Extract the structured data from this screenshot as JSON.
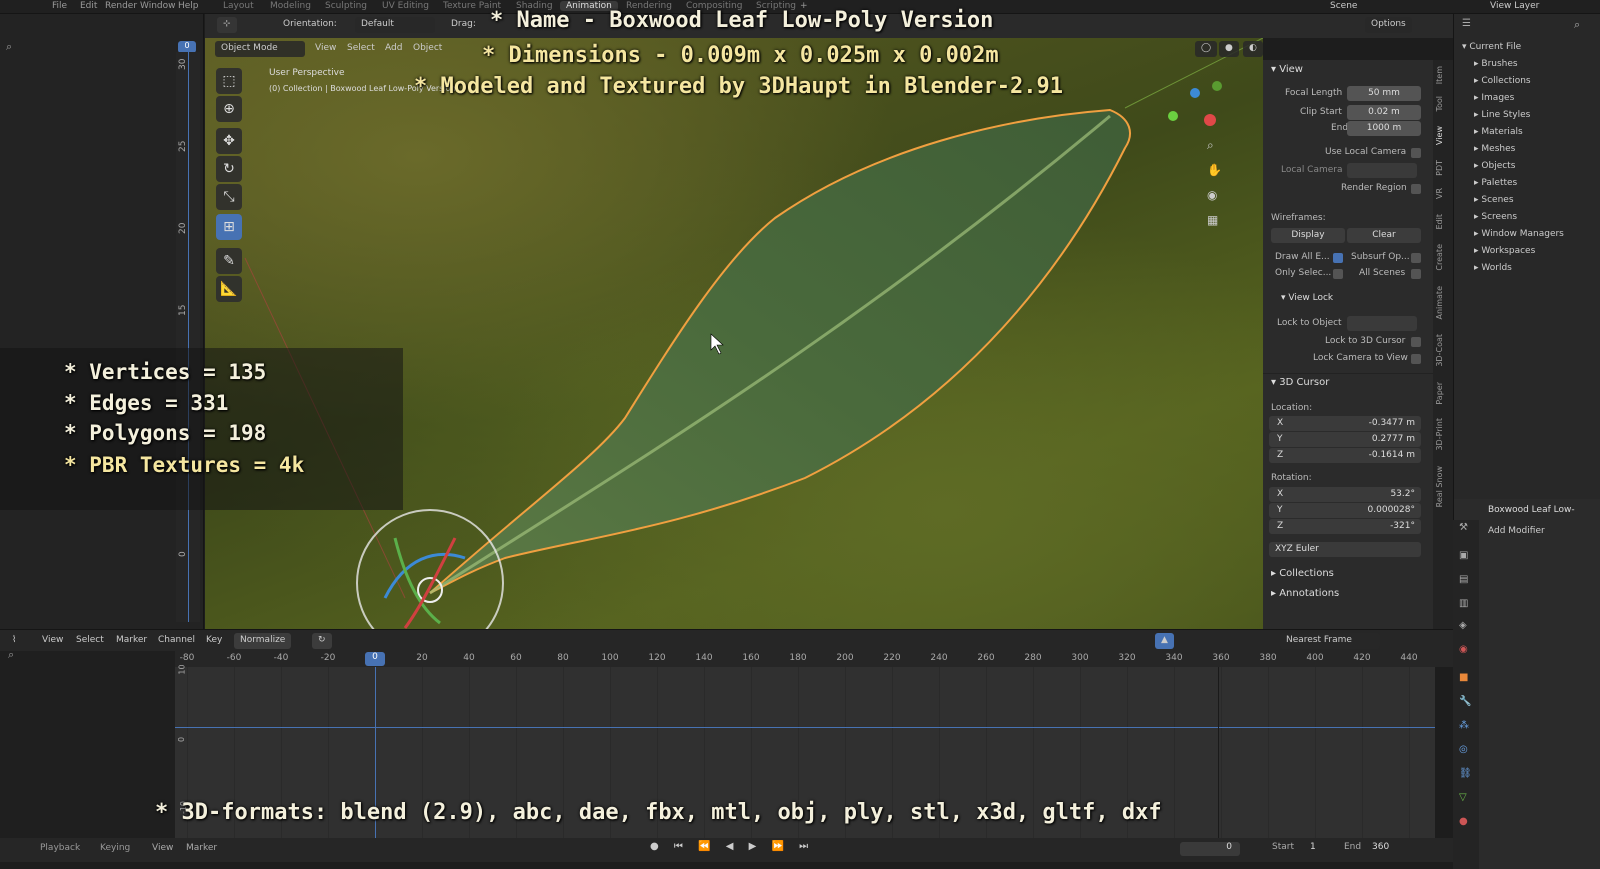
{
  "topbar": {
    "menus": [
      "File",
      "Edit",
      "Render",
      "Window",
      "Help"
    ],
    "workspace_tabs": [
      "Layout",
      "Modeling",
      "Sculpting",
      "UV Editing",
      "Texture Paint",
      "Shading",
      "Animation",
      "Rendering",
      "Compositing",
      "Scripting"
    ],
    "active_tab": "Animation",
    "scene": "Scene",
    "view_layer": "View Layer"
  },
  "viewport_header": {
    "orientation_label": "Orientation:",
    "orientation_value": "Default",
    "drag_label": "Drag:",
    "mode": "Object Mode",
    "menus": [
      "View",
      "Select",
      "Add",
      "Object"
    ],
    "options": "Options",
    "frame_field": "0"
  },
  "viewport": {
    "perspective": "User Perspective",
    "collection": "(0) Collection | Boxwood Leaf Low-Poly Version"
  },
  "overlay": {
    "line1": "* Name - Boxwood Leaf Low-Poly Version",
    "line2": "* Dimensions -  0.009m x 0.025m x 0.002m",
    "line3": "* Modeled and Textured by 3DHaupt in Blender-2.91",
    "stats": [
      "* Vertices = 135",
      "* Edges = 331",
      "* Polygons = 198",
      "* PBR Textures = 4k"
    ],
    "formats": "* 3D-formats: blend (2.9), abc, dae, fbx, mtl, obj, ply, stl, x3d, gltf, dxf"
  },
  "ruler": [
    "30",
    "25",
    "20",
    "15",
    "0"
  ],
  "npanel": {
    "view_title": "View",
    "focal_length_label": "Focal Length",
    "focal_length": "50 mm",
    "clip_start_label": "Clip Start",
    "clip_start": "0.02 m",
    "end_label": "End",
    "end": "1000 m",
    "use_local_camera": "Use Local Camera",
    "local_camera": "Local Camera",
    "render_region": "Render Region",
    "wireframes": "Wireframes:",
    "display": "Display",
    "clear": "Clear",
    "draw_all": "Draw All E...",
    "subsurf": "Subsurf Op...",
    "only_selec": "Only Selec...",
    "all_scenes": "All Scenes",
    "view_lock": "View Lock",
    "lock_to_object": "Lock to Object",
    "lock_3d_cursor": "Lock to 3D Cursor",
    "lock_camera": "Lock Camera to View",
    "cursor_title": "3D Cursor",
    "location": "Location:",
    "loc": [
      {
        "axis": "X",
        "value": "-0.3477 m"
      },
      {
        "axis": "Y",
        "value": "0.2777 m"
      },
      {
        "axis": "Z",
        "value": "-0.1614 m"
      }
    ],
    "rotation": "Rotation:",
    "rot": [
      {
        "axis": "X",
        "value": "53.2°"
      },
      {
        "axis": "Y",
        "value": "0.000028°"
      },
      {
        "axis": "Z",
        "value": "-321°"
      }
    ],
    "euler": "XYZ Euler",
    "collections": "Collections",
    "annotations": "Annotations",
    "tabs": [
      "Item",
      "Tool",
      "View",
      "PDT",
      "VR",
      "Edit",
      "Create",
      "Animate",
      "3D-Coat",
      "Paper",
      "3D-Print",
      "Real Snow"
    ]
  },
  "outliner": {
    "root": "Current File",
    "items": [
      "Brushes",
      "Collections",
      "Images",
      "Line Styles",
      "Materials",
      "Meshes",
      "Objects",
      "Palettes",
      "Scenes",
      "Screens",
      "Window Managers",
      "Workspaces",
      "Worlds"
    ]
  },
  "properties": {
    "object": "Boxwood Leaf Low-",
    "add_modifier": "Add Modifier"
  },
  "timeline": {
    "menus": [
      "View",
      "Select",
      "Marker",
      "Channel",
      "Key"
    ],
    "normalize": "Normalize",
    "snap": "Nearest Frame",
    "ticks": [
      "-80",
      "-60",
      "-40",
      "-20",
      "0",
      "20",
      "40",
      "60",
      "80",
      "100",
      "120",
      "140",
      "160",
      "180",
      "200",
      "220",
      "240",
      "260",
      "280",
      "300",
      "320",
      "340",
      "360",
      "380",
      "400",
      "420",
      "440"
    ],
    "current_frame": "0",
    "vlabels": [
      "10",
      "0",
      "-10"
    ]
  },
  "statusbar": {
    "playback": "Playback",
    "keying": "Keying",
    "view": "View",
    "marker": "Marker",
    "frame": "0",
    "start_label": "Start",
    "start": "1",
    "end_label": "End",
    "end": "360"
  },
  "colors": {
    "accent": "#4772b3",
    "leaf": "#4f6e3c",
    "selection": "#f0a040"
  }
}
